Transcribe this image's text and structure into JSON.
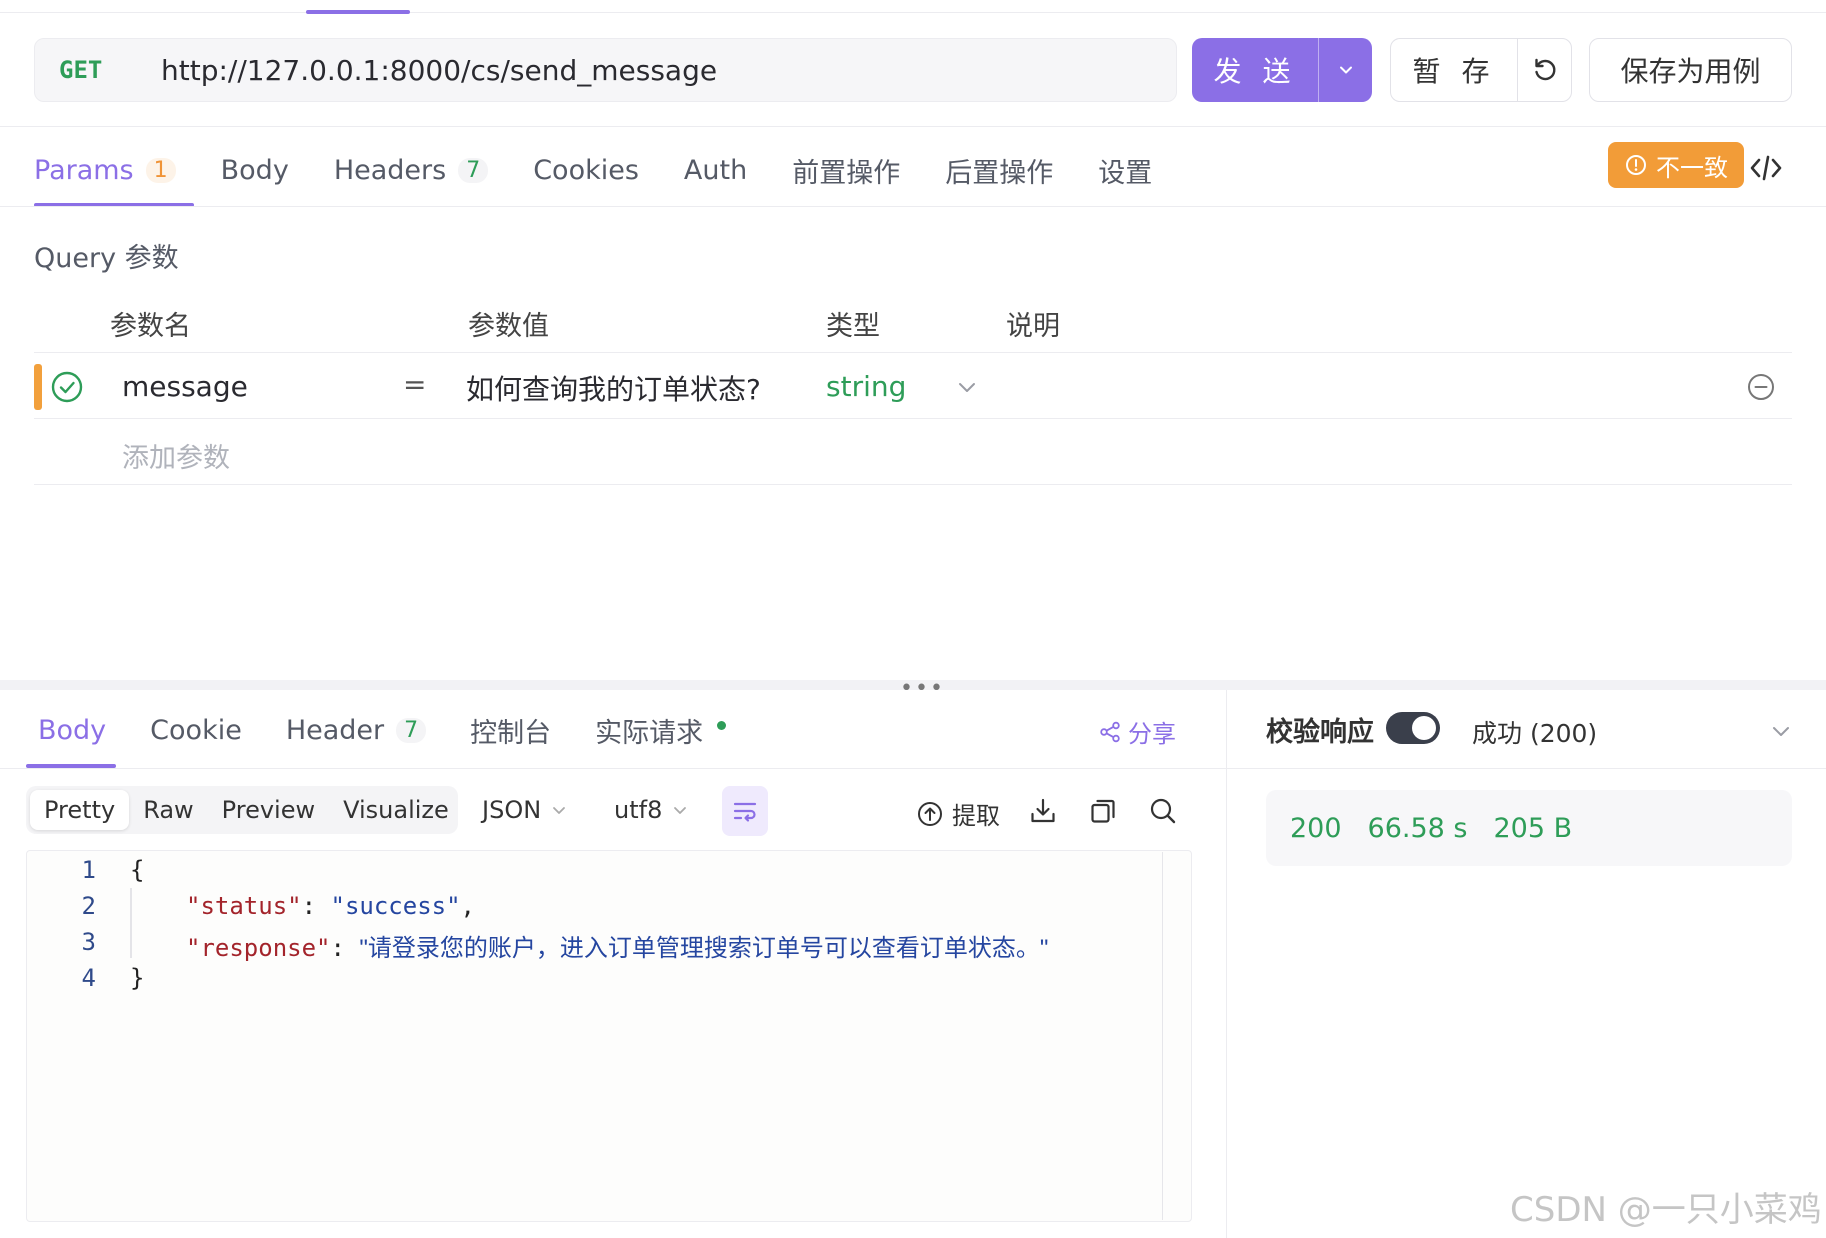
{
  "request": {
    "method": "GET",
    "url": "http://127.0.0.1:8000/cs/send_message",
    "send_label": "发 送",
    "save_label": "暂 存",
    "save_case_label": "保存为用例"
  },
  "request_tabs": [
    {
      "label": "Params",
      "badge": "1",
      "active": true
    },
    {
      "label": "Body"
    },
    {
      "label": "Headers",
      "badge": "7"
    },
    {
      "label": "Cookies"
    },
    {
      "label": "Auth"
    },
    {
      "label": "前置操作"
    },
    {
      "label": "后置操作"
    },
    {
      "label": "设置"
    }
  ],
  "mismatch_label": "不一致",
  "params": {
    "section_title": "Query 参数",
    "columns": [
      "参数名",
      "参数值",
      "类型",
      "说明"
    ],
    "rows": [
      {
        "name": "message",
        "eq": "=",
        "value": "如何查询我的订单状态?",
        "type": "string"
      }
    ],
    "add_placeholder": "添加参数"
  },
  "response_tabs": [
    {
      "label": "Body",
      "active": true
    },
    {
      "label": "Cookie"
    },
    {
      "label": "Header",
      "badge": "7"
    },
    {
      "label": "控制台"
    },
    {
      "label": "实际请求"
    }
  ],
  "share_label": "分享",
  "formats": [
    "Pretty",
    "Raw",
    "Preview",
    "Visualize"
  ],
  "format_active": "Pretty",
  "format_select": "JSON",
  "encoding_select": "utf8",
  "extract_label": "提取",
  "code": {
    "line_numbers": [
      "1",
      "2",
      "3",
      "4"
    ],
    "open_brace": "{",
    "close_brace": "}",
    "key_status": "\"status\"",
    "val_status": "\"success\"",
    "key_response": "\"response\"",
    "val_response": "\"请登录您的账户，进入订单管理搜索订单号可以查看订单状态。\""
  },
  "verify": {
    "label": "校验响应",
    "status_option": "成功 (200)"
  },
  "stats": {
    "status_code": "200",
    "time": "66.58 s",
    "size": "205 B"
  },
  "watermark": "CSDN @一只小菜鸡",
  "colors": {
    "accent": "#8b6fe6",
    "success": "#2e9d58",
    "warning": "#f29c38"
  }
}
